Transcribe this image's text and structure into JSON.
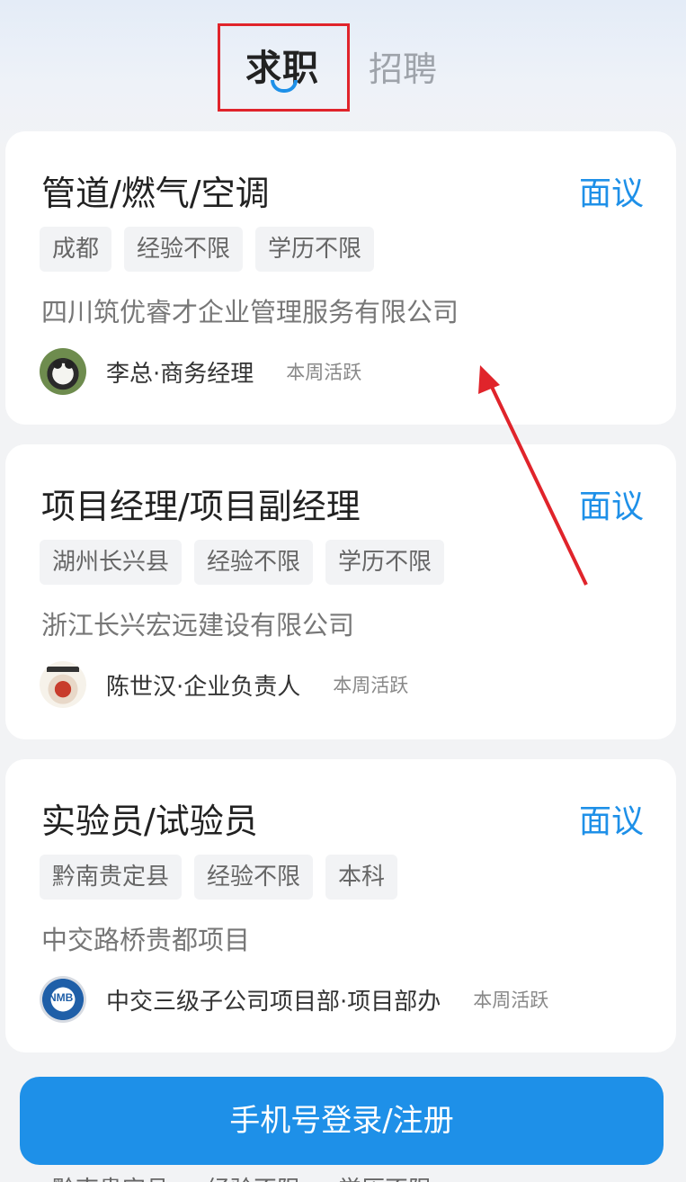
{
  "tabs": {
    "active": "求职",
    "inactive": "招聘"
  },
  "jobs": [
    {
      "title": "管道/燃气/空调",
      "salary": "面议",
      "tags": [
        "成都",
        "经验不限",
        "学历不限"
      ],
      "company": "四川筑优睿才企业管理服务有限公司",
      "recruiter": "李总·商务经理",
      "activity": "本周活跃",
      "avatar": "panda-avatar"
    },
    {
      "title": "项目经理/项目副经理",
      "salary": "面议",
      "tags": [
        "湖州长兴县",
        "经验不限",
        "学历不限"
      ],
      "company": "浙江长兴宏远建设有限公司",
      "recruiter": "陈世汉·企业负责人",
      "activity": "本周活跃",
      "avatar": "figure-avatar"
    },
    {
      "title": "实验员/试验员",
      "salary": "面议",
      "tags": [
        "黔南贵定县",
        "经验不限",
        "本科"
      ],
      "company": "中交路桥贵都项目",
      "recruiter": "中交三级子公司项目部·项目部办",
      "activity": "本周活跃",
      "avatar": "logo-avatar",
      "avatar_text": "NMB"
    }
  ],
  "login_button": "手机号登录/注册",
  "colors": {
    "accent": "#1e90e8",
    "highlight_box": "#e0242b",
    "annotation_arrow": "#e0242b"
  }
}
